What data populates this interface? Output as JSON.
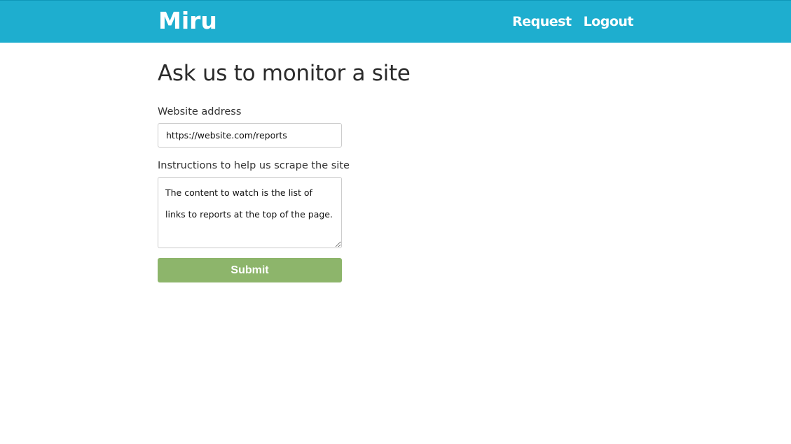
{
  "header": {
    "brand": "Miru",
    "nav": [
      {
        "label": "Request"
      },
      {
        "label": "Logout"
      }
    ],
    "background_color": "#1eaecf"
  },
  "main": {
    "title": "Ask us to monitor a site",
    "form": {
      "website_label": "Website address",
      "website_value": "https://website.com/reports",
      "instructions_label": "Instructions to help us scrape the site",
      "instructions_value": "The content to watch is the list of links to reports at the top of the page.",
      "submit_label": "Submit",
      "submit_color": "#8db56b"
    }
  }
}
